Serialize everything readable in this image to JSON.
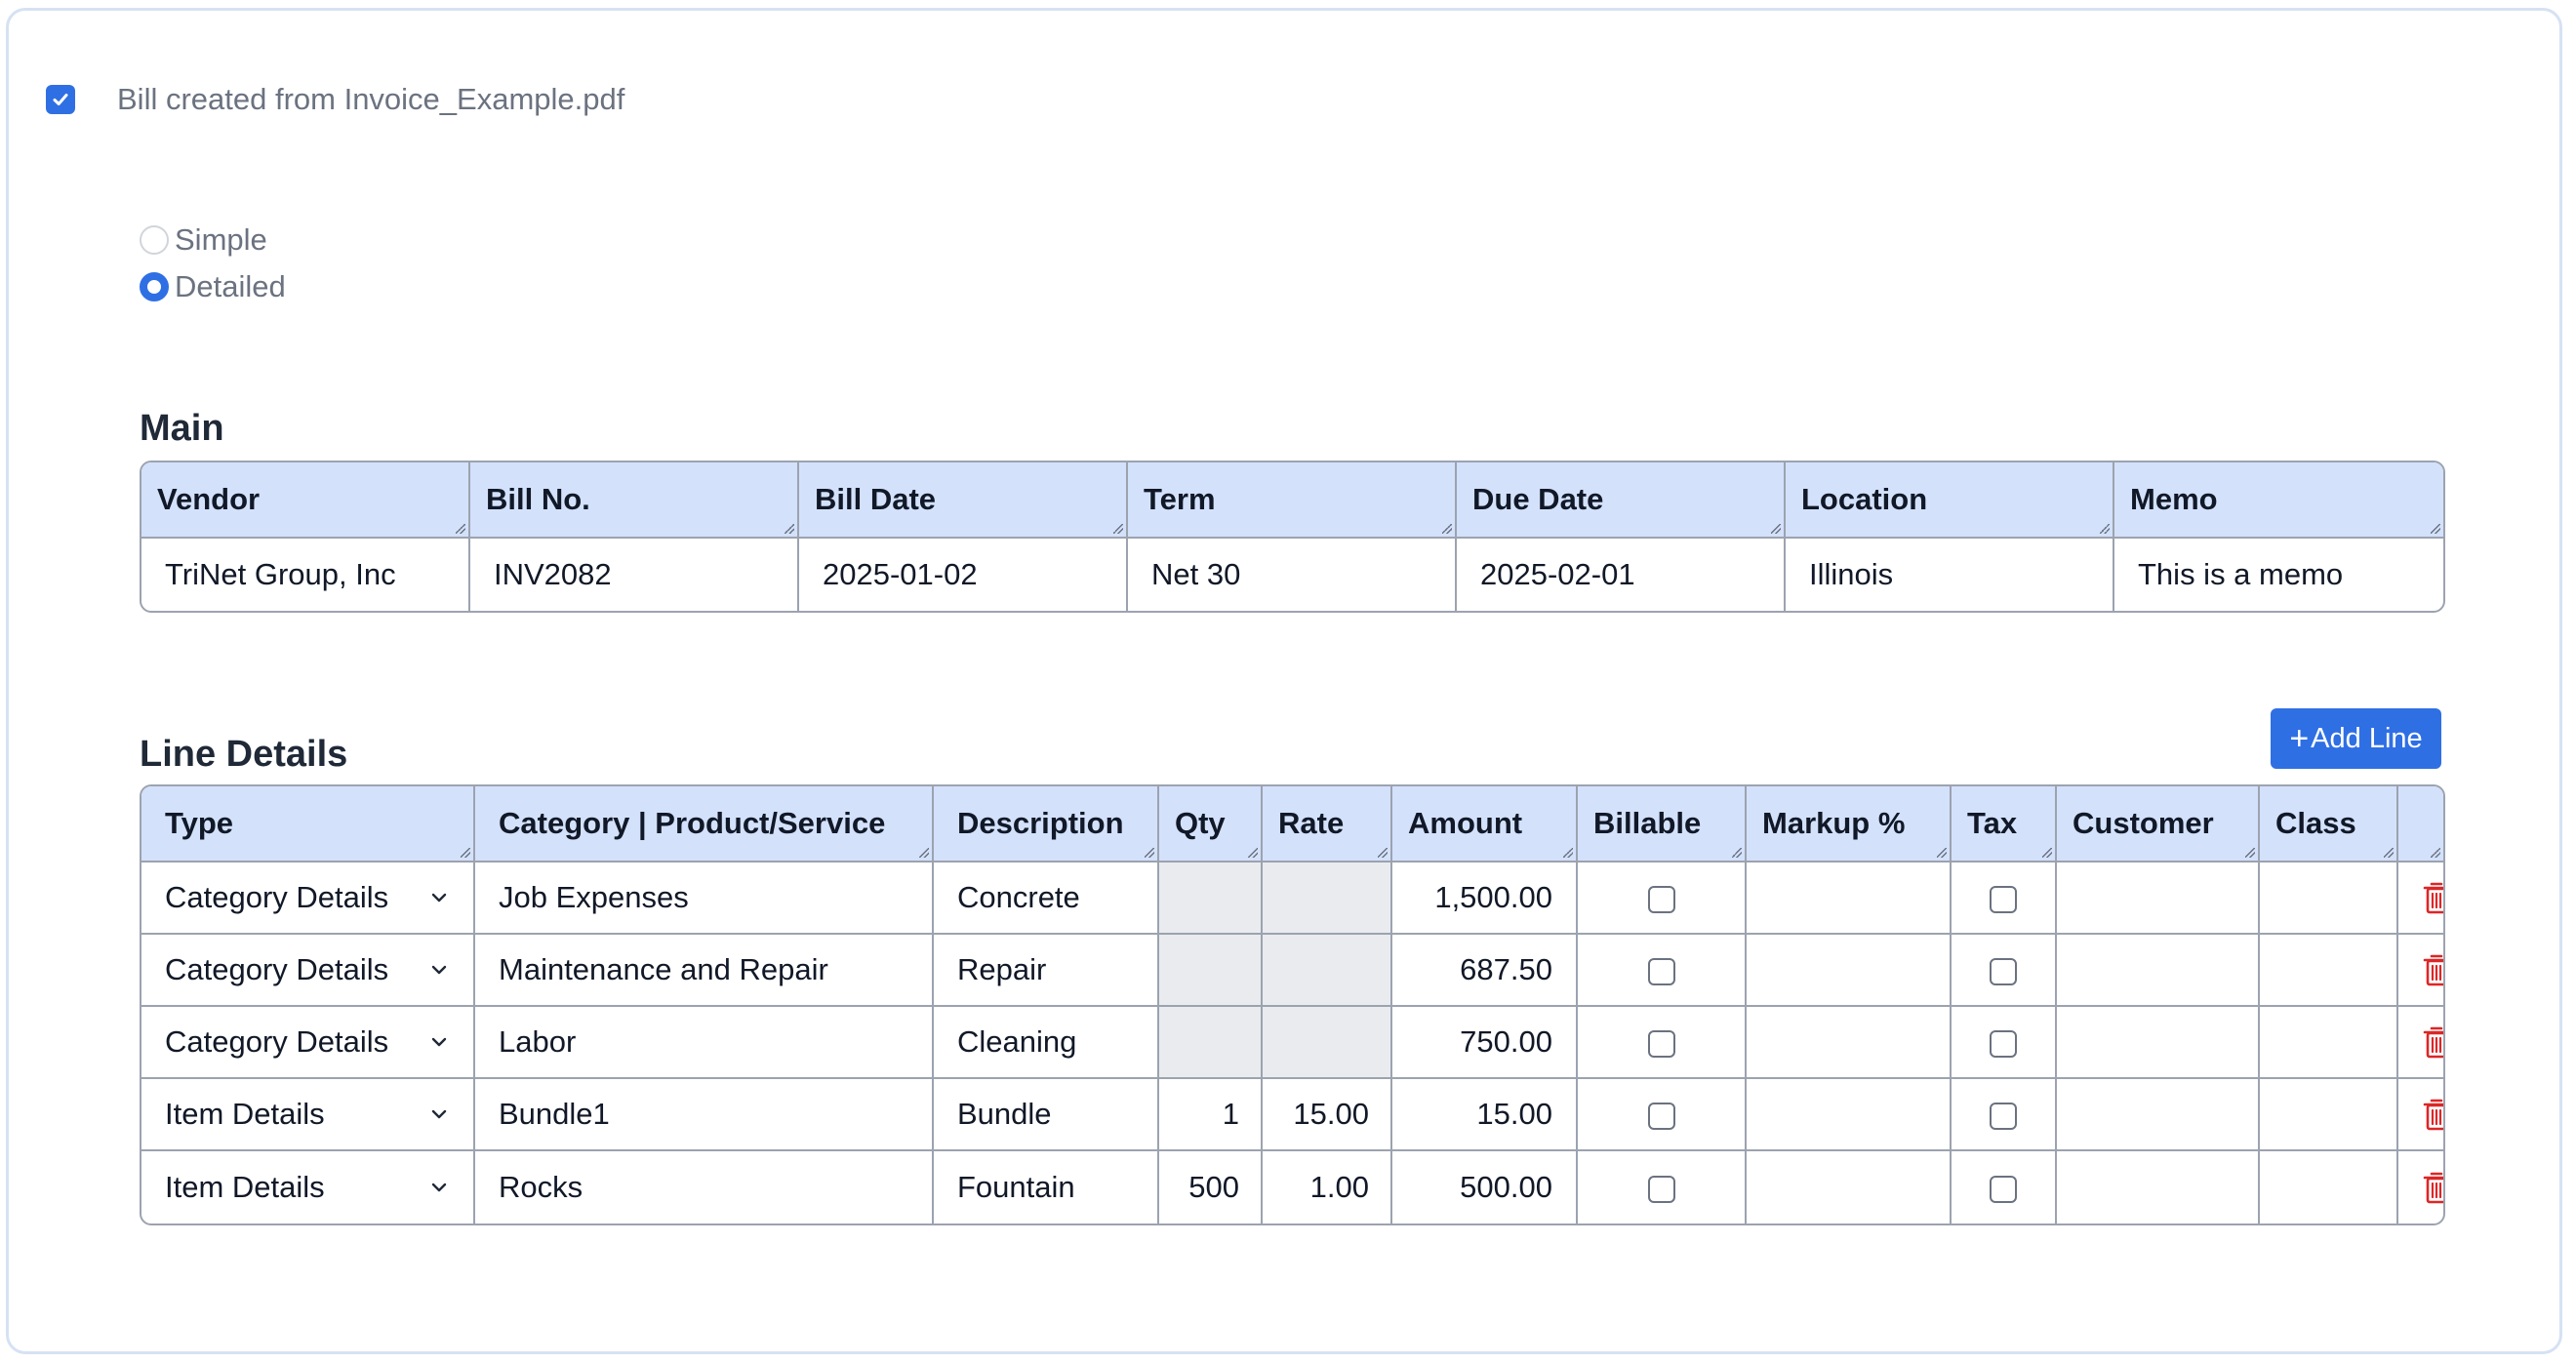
{
  "header": {
    "bill_created_label": "Bill created from Invoice_Example.pdf",
    "bill_created_checked": true
  },
  "view_mode": {
    "options": [
      "Simple",
      "Detailed"
    ],
    "selected": "Detailed"
  },
  "main": {
    "title": "Main",
    "columns": [
      "Vendor",
      "Bill No.",
      "Bill Date",
      "Term",
      "Due Date",
      "Location",
      "Memo"
    ],
    "values": [
      "TriNet Group, Inc",
      "INV2082",
      "2025-01-02",
      "Net 30",
      "2025-02-01",
      "Illinois",
      "This is a memo"
    ]
  },
  "line_details": {
    "title": "Line Details",
    "add_line_label": "Add Line",
    "add_line_icon": "plus-icon",
    "columns": [
      "Type",
      "Category | Product/Service",
      "Description",
      "Qty",
      "Rate",
      "Amount",
      "Billable",
      "Markup %",
      "Tax",
      "Customer",
      "Class",
      ""
    ],
    "rows": [
      {
        "type": "Category Details",
        "category": "Job Expenses",
        "description": "Concrete",
        "qty": "",
        "rate": "",
        "amount": "1,500.00",
        "billable": false,
        "markup": "",
        "tax": false,
        "customer": "",
        "class": ""
      },
      {
        "type": "Category Details",
        "category": "Maintenance and Repair",
        "description": "Repair",
        "qty": "",
        "rate": "",
        "amount": "687.50",
        "billable": false,
        "markup": "",
        "tax": false,
        "customer": "",
        "class": ""
      },
      {
        "type": "Category Details",
        "category": "Labor",
        "description": "Cleaning",
        "qty": "",
        "rate": "",
        "amount": "750.00",
        "billable": false,
        "markup": "",
        "tax": false,
        "customer": "",
        "class": ""
      },
      {
        "type": "Item Details",
        "category": "Bundle1",
        "description": "Bundle",
        "qty": "1",
        "rate": "15.00",
        "amount": "15.00",
        "billable": false,
        "markup": "",
        "tax": false,
        "customer": "",
        "class": ""
      },
      {
        "type": "Item Details",
        "category": "Rocks",
        "description": "Fountain",
        "qty": "500",
        "rate": "1.00",
        "amount": "500.00",
        "billable": false,
        "markup": "",
        "tax": false,
        "customer": "",
        "class": ""
      }
    ]
  },
  "colors": {
    "accent": "#2f6fe4",
    "header_bg": "#d3e1fb",
    "delete_red": "#dc2626",
    "disabled_cell": "#e9ebef"
  }
}
